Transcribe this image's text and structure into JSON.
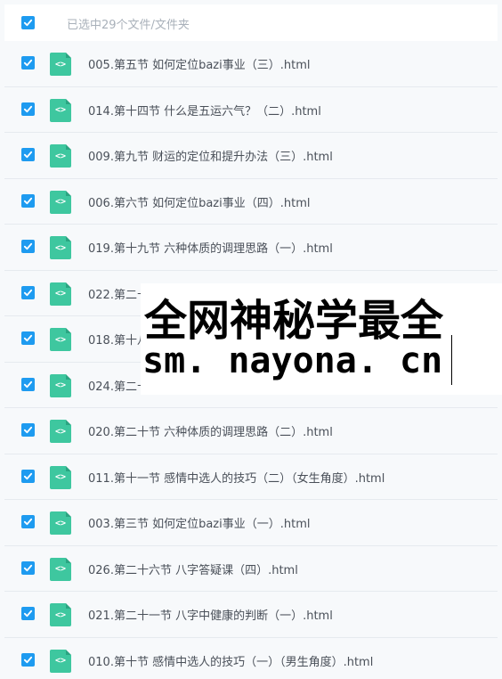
{
  "header": {
    "selection_text": "已选中29个文件/文件夹",
    "select_all_checked": true
  },
  "files": [
    {
      "name": "005.第五节 如何定位bazi事业（三）.html",
      "checked": true
    },
    {
      "name": "014.第十四节 什么是五运六气？（二）.html",
      "checked": true
    },
    {
      "name": "009.第九节 财运的定位和提升办法（三）.html",
      "checked": true
    },
    {
      "name": "006.第六节 如何定位bazi事业（四）.html",
      "checked": true
    },
    {
      "name": "019.第十九节 六种体质的调理思路（一）.html",
      "checked": true
    },
    {
      "name": "022.第二十",
      "checked": true
    },
    {
      "name": "018.第十八",
      "checked": true
    },
    {
      "name": "024.第二十",
      "checked": true
    },
    {
      "name": "020.第二十节 六种体质的调理思路（二）.html",
      "checked": true
    },
    {
      "name": "011.第十一节 感情中选人的技巧（二）（女生角度）.html",
      "checked": true
    },
    {
      "name": "003.第三节 如何定位bazi事业（一）.html",
      "checked": true
    },
    {
      "name": "026.第二十六节 八字答疑课（四）.html",
      "checked": true
    },
    {
      "name": "021.第二十一节 八字中健康的判断（一）.html",
      "checked": true
    },
    {
      "name": "010.第十节 感情中选人的技巧（一）（男生角度）.html",
      "checked": true
    }
  ],
  "file_icon_glyph": "<>",
  "watermark": {
    "line1": "全网神秘学最全",
    "line2": "sm. nayona. cn"
  },
  "colors": {
    "checkbox": "#1e9bf0",
    "file_icon": "#3ec79f",
    "text": "#4a5059",
    "header_text": "#a9b1ba"
  }
}
